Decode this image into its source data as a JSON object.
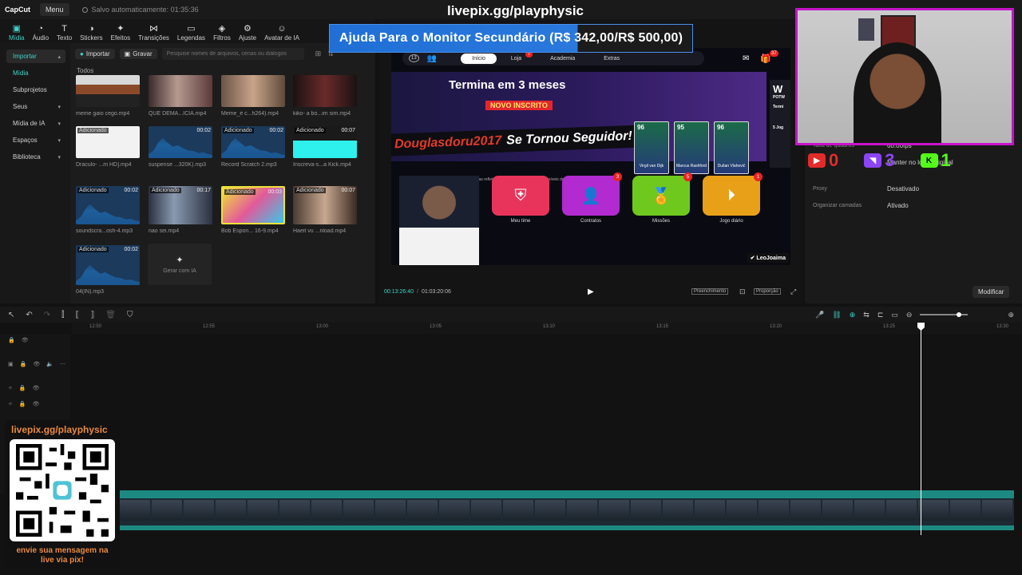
{
  "app": {
    "logo_text": "CapCut",
    "menu_label": "Menu",
    "autosave_text": "Salvo automaticamente: 01:35:36",
    "stream_url": "livepix.gg/playphysic"
  },
  "toolbar": {
    "tools": [
      {
        "label": "Mídia",
        "icon": "media-icon"
      },
      {
        "label": "Áudio",
        "icon": "audio-icon"
      },
      {
        "label": "Texto",
        "icon": "text-icon"
      },
      {
        "label": "Stickers",
        "icon": "sticker-icon"
      },
      {
        "label": "Efeitos",
        "icon": "effects-icon"
      },
      {
        "label": "Transições",
        "icon": "transitions-icon"
      },
      {
        "label": "Legendas",
        "icon": "captions-icon"
      },
      {
        "label": "Filtros",
        "icon": "filters-icon"
      },
      {
        "label": "Ajuste",
        "icon": "adjust-icon"
      },
      {
        "label": "Avatar de IA",
        "icon": "ai-avatar-icon"
      }
    ]
  },
  "leftnav": {
    "items": [
      {
        "label": "Importar"
      },
      {
        "label": "Mídia"
      },
      {
        "label": "Subprojetos"
      },
      {
        "label": "Seus"
      },
      {
        "label": "Mídia de IA"
      },
      {
        "label": "Espaços"
      },
      {
        "label": "Biblioteca"
      }
    ]
  },
  "media": {
    "import_label": "Importar",
    "record_label": "Gravar",
    "search_placeholder": "Pesquise nomes de arquivos, cenas ou diálogos",
    "section_label": "Todos",
    "added_label": "Adicionado",
    "ai_generate_label": "Gerar com IA",
    "items": [
      {
        "caption": "meme gaio cego.mp4",
        "duration": ""
      },
      {
        "caption": "QUE DEMA...ÍCIA.mp4",
        "duration": ""
      },
      {
        "caption": "Meme_é c...h264).mp4",
        "duration": ""
      },
      {
        "caption": "kiko- a bo...im sim.mp4",
        "duration": ""
      },
      {
        "caption": "Draculo- ...m HD].mp4",
        "duration": ""
      },
      {
        "caption": "suspense ...320K).mp3",
        "duration": "00:02"
      },
      {
        "caption": "Record Scratch 2.mp3",
        "duration": "00:02"
      },
      {
        "caption": "Inscreva-s...a Kick.mp4",
        "duration": "00:07"
      },
      {
        "caption": "soundscra...osh-4.mp3",
        "duration": "00:02"
      },
      {
        "caption": "nao sei.mp4",
        "duration": "00:17"
      },
      {
        "caption": "Bob Espon... 16-9.mp4",
        "duration": "00:03"
      },
      {
        "caption": "Haeit vu ...nload.mp4",
        "duration": "00:07"
      },
      {
        "caption": "04(IN).mp3",
        "duration": "00:02"
      }
    ]
  },
  "preview": {
    "donation_text": "Ajuda Para o Monitor Secundário (R$ 342,00/R$ 500,00)",
    "donation_progress": 0.684,
    "game_nav": [
      "Início",
      "Loja",
      "Academia",
      "Extras"
    ],
    "game_level": "13",
    "game_nav_badge": "7",
    "game_gift_count": "37",
    "promo_headline": "Termina em 3 meses",
    "promo_badge": "NOVO INSCRITO",
    "follow_user": "Douglasdoru2017",
    "follow_text": "Se Tornou Seguidor!",
    "cards": [
      {
        "rating": "96",
        "name": "Virgil van Dijk"
      },
      {
        "rating": "95",
        "name": "Marcus Rashford"
      },
      {
        "rating": "96",
        "name": "Dušan Vlahović"
      }
    ],
    "disclaimer": "* As pontuações gerais exibidas refletem as maiores pontuações possíveis dos jogadores.",
    "side_letter": "W",
    "side_sub1": "POTW",
    "side_sub2": "Termi",
    "side_sub3": "5 Jog",
    "tiles": [
      {
        "label": "Meu time",
        "badge": "",
        "color": "#e8345a",
        "icon": "shield-icon"
      },
      {
        "label": "Contratos",
        "badge": "3",
        "color": "#b12bd0",
        "icon": "user-plus-icon"
      },
      {
        "label": "Missões",
        "badge": "5",
        "color": "#6ec81e",
        "icon": "medal-icon"
      },
      {
        "label": "Jogo diário",
        "badge": "1",
        "color": "#e8a018",
        "icon": "play-store-icon"
      }
    ],
    "channel_tag": "LeoJoaima",
    "timecode_current": "00:13:26:40",
    "timecode_total": "01:03:20:06",
    "fill_label": "Preenchimento",
    "ratio_label": "Proporção"
  },
  "props": {
    "rows": [
      {
        "label": "Taxa de quadros",
        "value": "60.00fps"
      },
      {
        "label": "Proxy",
        "value": "Desativado"
      },
      {
        "label": "Organizar camadas",
        "value": "Ativado"
      }
    ],
    "source_text": "Manter no local original",
    "modify_label": "Modificar",
    "social": [
      {
        "name": "youtube-icon",
        "count": "0",
        "color": "#e22b2b"
      },
      {
        "name": "twitch-icon",
        "count": "3",
        "color": "#8c44f7"
      },
      {
        "name": "kick-icon",
        "count": "1",
        "color": "#53fc18"
      }
    ]
  },
  "timeline": {
    "ticks": [
      "12:50",
      "12:55",
      "13:00",
      "13:05",
      "13:10",
      "13:15",
      "13:20",
      "13:25",
      "13:30"
    ]
  },
  "qr": {
    "title": "livepix.gg/playphysic",
    "message_line1": "envie sua mensagem na",
    "message_line2": "live via pix!"
  }
}
